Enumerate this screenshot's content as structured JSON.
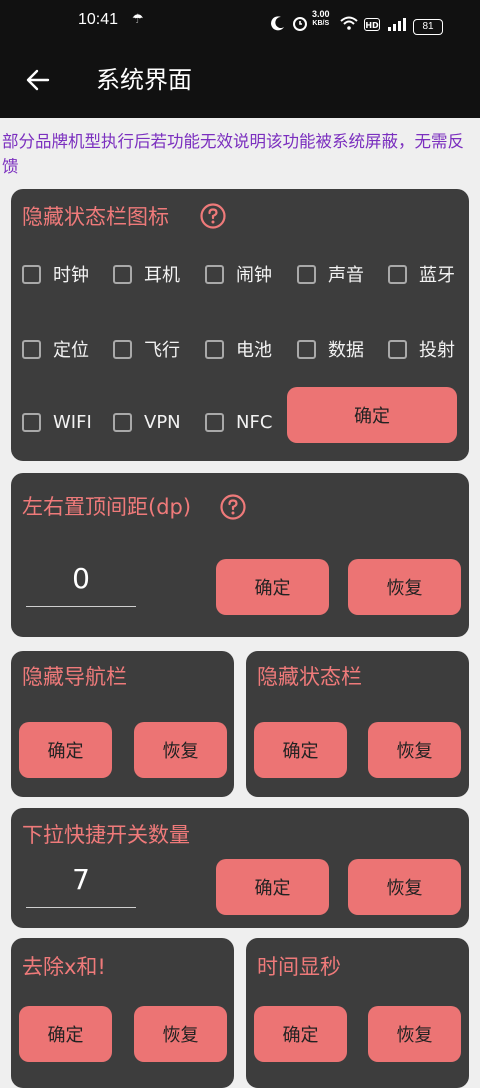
{
  "status_bar": {
    "time": "10:41",
    "speed_value": "3.00",
    "speed_unit": "KB/S",
    "hd_badge": "HD",
    "battery": "81"
  },
  "app_bar": {
    "title": "系统界面"
  },
  "notice": "部分品牌机型执行后若功能无效说明该功能被系统屏蔽，无需反馈",
  "hide_statusbar_icons": {
    "title": "隐藏状态栏图标",
    "options_row1": [
      "时钟",
      "耳机",
      "闹钟",
      "声音",
      "蓝牙"
    ],
    "options_row2": [
      "定位",
      "飞行",
      "电池",
      "数据",
      "投射"
    ],
    "options_row3": [
      "WIFI",
      "VPN",
      "NFC"
    ],
    "confirm_label": "确定"
  },
  "padding_card": {
    "title": "左右置顶间距(dp)",
    "value": "0",
    "confirm_label": "确定",
    "restore_label": "恢复"
  },
  "hide_navbar": {
    "title": "隐藏导航栏",
    "confirm_label": "确定",
    "restore_label": "恢复"
  },
  "hide_statusbar": {
    "title": "隐藏状态栏",
    "confirm_label": "确定",
    "restore_label": "恢复"
  },
  "quick_settings": {
    "title": "下拉快捷开关数量",
    "value": "7",
    "confirm_label": "确定",
    "restore_label": "恢复"
  },
  "remove_x": {
    "title": "去除x和!",
    "confirm_label": "确定",
    "restore_label": "恢复"
  },
  "show_seconds": {
    "title": "时间显秒",
    "confirm_label": "确定",
    "restore_label": "恢复"
  },
  "colors": {
    "accent": "#ec7474",
    "title_text": "#ef7a7a",
    "card_bg": "#3d3d3d",
    "notice_text": "#7b2fbf"
  }
}
